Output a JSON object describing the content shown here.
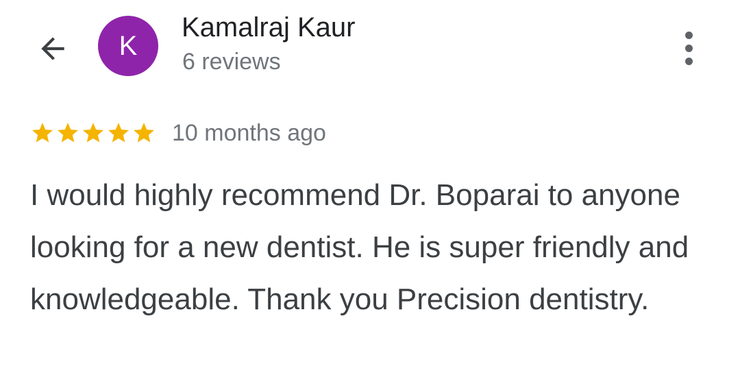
{
  "header": {
    "back_icon": "arrow-back-icon",
    "avatar_letter": "K",
    "avatar_color": "#8e24aa",
    "user_name": "Kamalraj Kaur",
    "review_count": "6 reviews",
    "more_icon": "more-vert-icon"
  },
  "review": {
    "rating": 5,
    "max_rating": 5,
    "star_color": "#f4b400",
    "time_ago": "10 months ago",
    "text": "I would highly recommend Dr. Boparai to anyone looking for a new dentist. He is super friendly and knowledgeable. Thank you Precision dentistry."
  }
}
